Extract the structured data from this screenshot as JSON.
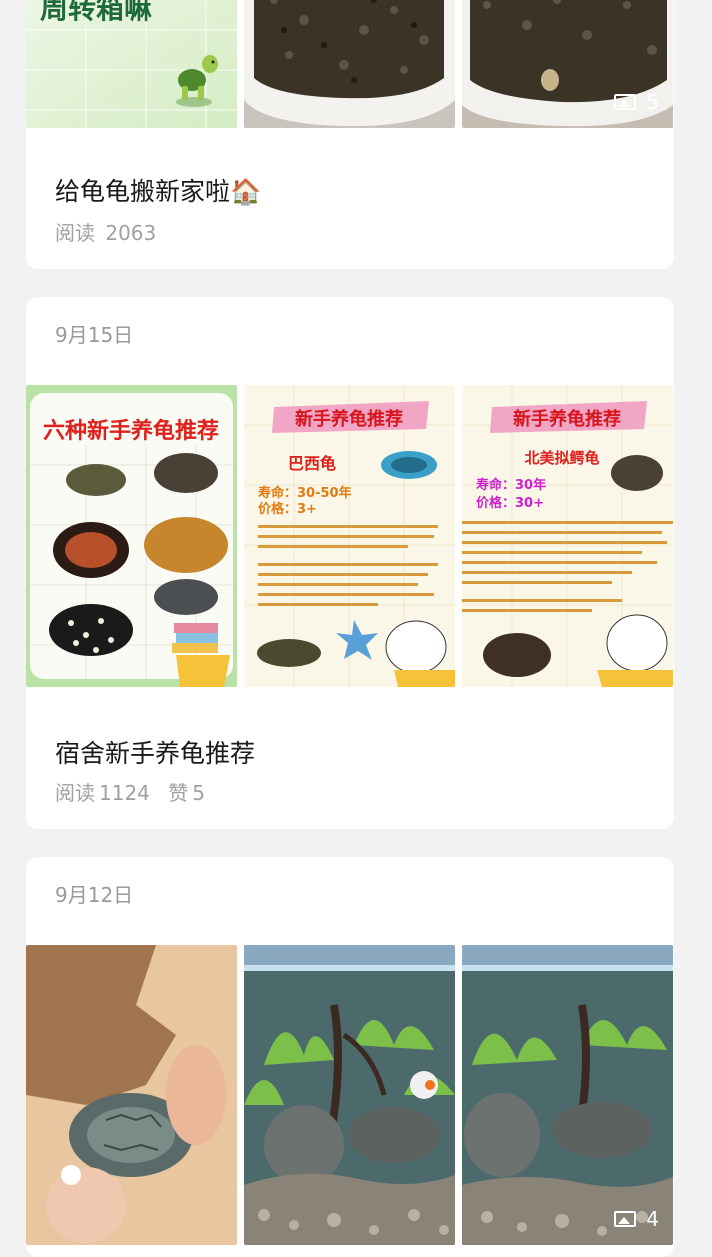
{
  "posts": [
    {
      "date": "",
      "cover_text": "周转箱嘛",
      "image_count": "5",
      "title": "给龟龟搬新家啦🏠",
      "read_label": "阅读",
      "reads": "2063",
      "likes_label": "",
      "likes": ""
    },
    {
      "date": "9月15日",
      "image_count": "",
      "title": "宿舍新手养龟推荐",
      "read_label": "阅读",
      "reads": "1124",
      "likes_label": "赞",
      "likes": "5",
      "poster1": {
        "heading": "六种新手养龟推荐"
      },
      "poster2": {
        "heading": "新手养龟推荐",
        "name": "巴西龟",
        "life_label": "寿命：",
        "life": "30-50年",
        "price_label": "价格：",
        "price": "3+"
      },
      "poster3": {
        "heading": "新手养龟推荐",
        "name": "北美拟鳄龟",
        "life_label": "寿命：",
        "life": "30年",
        "price_label": "价格：",
        "price": "30+"
      }
    },
    {
      "date": "9月12日",
      "image_count": "4",
      "title": "",
      "read_label": "",
      "reads": "",
      "likes_label": "",
      "likes": ""
    }
  ],
  "colors": {
    "page_bg": "#f2f2f2",
    "card_bg": "#ffffff",
    "muted": "#999999",
    "title": "#1a1a1a"
  }
}
